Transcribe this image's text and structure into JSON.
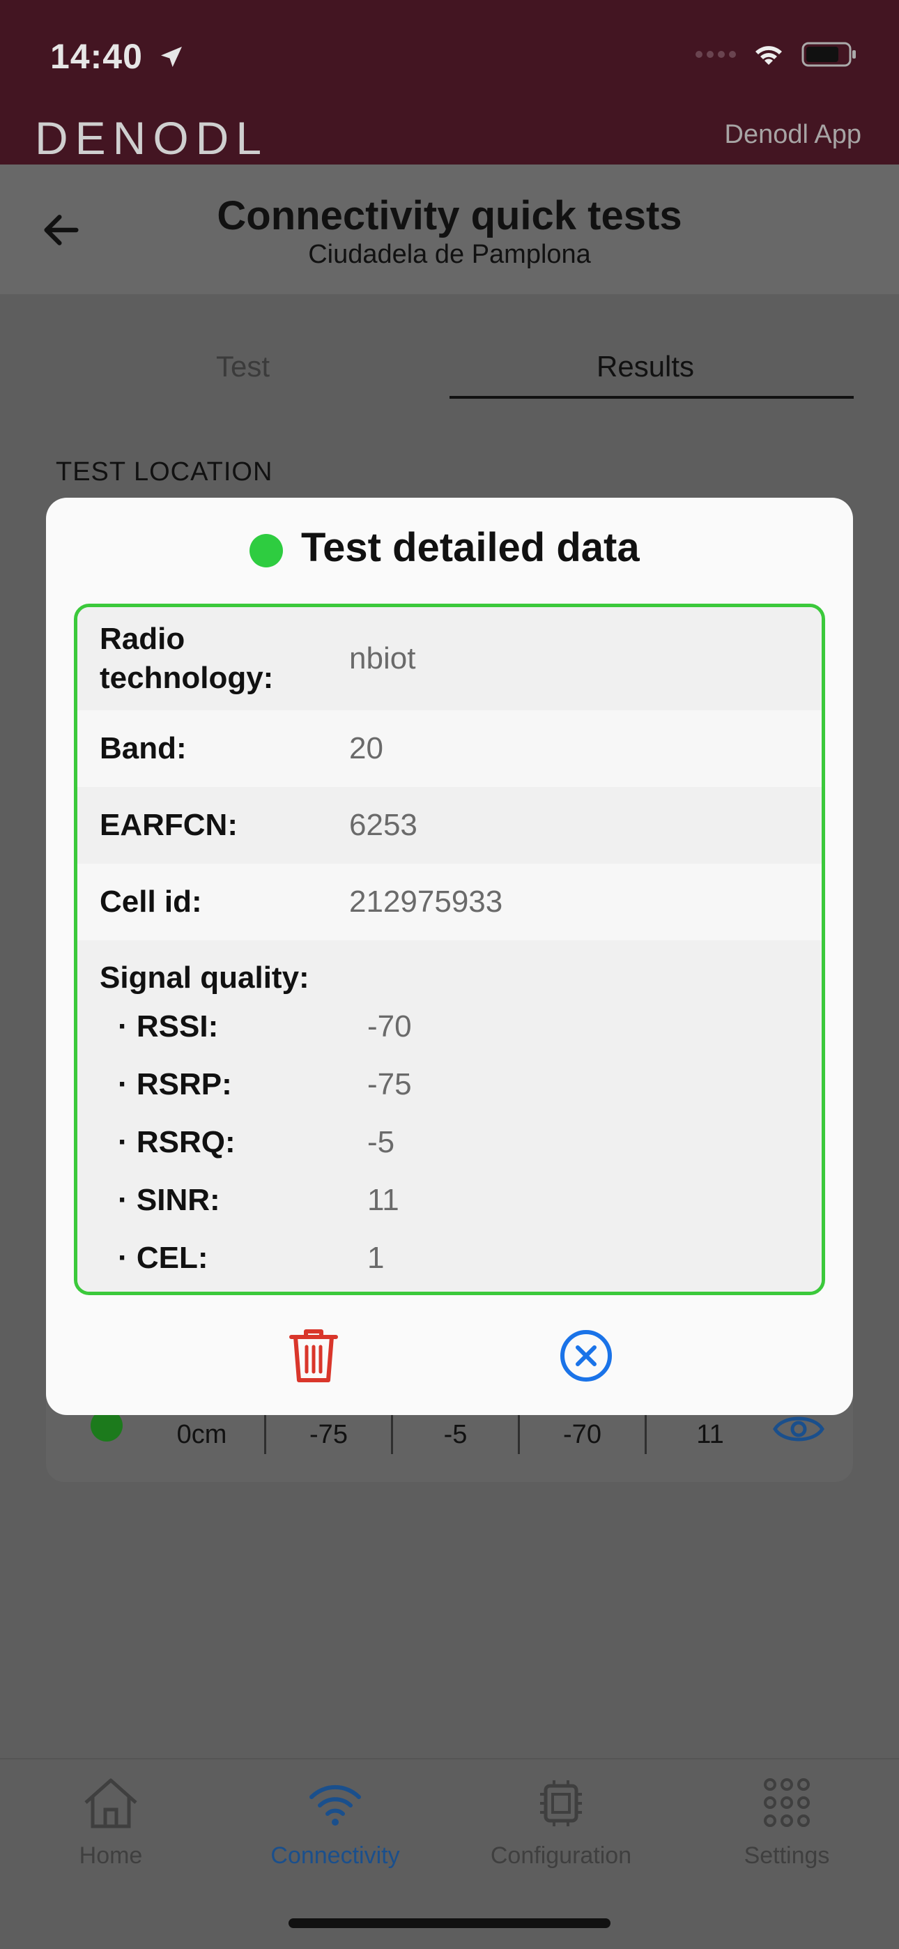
{
  "status_bar": {
    "time": "14:40"
  },
  "brand": {
    "logo_text": "DENODL",
    "app_name": "Denodl App"
  },
  "header": {
    "title": "Connectivity quick tests",
    "subtitle": "Ciudadela de Pamplona"
  },
  "tabs": [
    {
      "label": "Test"
    },
    {
      "label": "Results"
    }
  ],
  "section": {
    "label": "TEST LOCATION"
  },
  "background_row": {
    "cells": [
      "0cm",
      "-75",
      "-5",
      "-70",
      "11"
    ]
  },
  "modal": {
    "title": "Test detailed data",
    "status_color": "#2ecc40",
    "rows": [
      {
        "label": "Radio\ntechnology:",
        "value": "nbiot"
      },
      {
        "label": "Band:",
        "value": "20"
      },
      {
        "label": "EARFCN:",
        "value": "6253"
      },
      {
        "label": "Cell id:",
        "value": "212975933"
      }
    ],
    "signal": {
      "heading": "Signal quality:",
      "items": [
        {
          "label": "· RSSI:",
          "value": "-70"
        },
        {
          "label": "· RSRP:",
          "value": "-75"
        },
        {
          "label": "· RSRQ:",
          "value": "-5"
        },
        {
          "label": "· SINR:",
          "value": "11"
        },
        {
          "label": "· CEL:",
          "value": "1"
        }
      ]
    },
    "actions": {
      "delete_icon": "trash-icon",
      "close_icon": "close-circle-icon"
    }
  },
  "bottom_nav": [
    {
      "label": "Home",
      "icon": "home-icon"
    },
    {
      "label": "Connectivity",
      "icon": "wifi-icon",
      "active": true
    },
    {
      "label": "Configuration",
      "icon": "chip-icon"
    },
    {
      "label": "Settings",
      "icon": "grid-icon"
    }
  ],
  "colors": {
    "brand_bar": "#431522",
    "accent_blue": "#1a73e8",
    "success_green": "#3bc93b",
    "delete_red": "#d9362b"
  }
}
